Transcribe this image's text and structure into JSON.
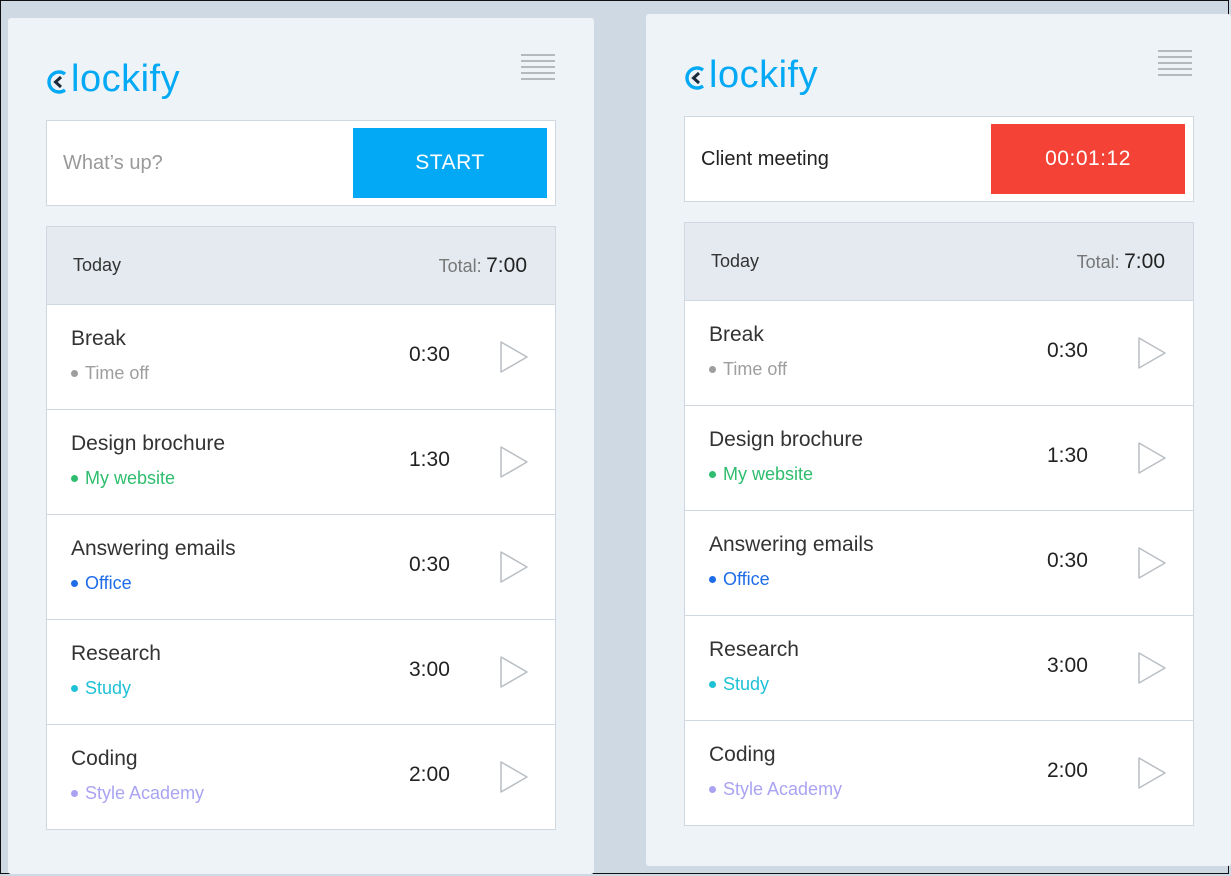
{
  "colors": {
    "brand": "#03a9f4",
    "start_button": "#03a9f4",
    "stop_button": "#f44336"
  },
  "panels": [
    {
      "logo": {
        "text": "lockify",
        "icon": "clockify-logo-icon"
      },
      "timer": {
        "description": "",
        "placeholder": "What’s up?",
        "button_label": "START",
        "running": false
      },
      "list": {
        "day_label": "Today",
        "total_label": "Total:",
        "total_value": "7:00",
        "entries": [
          {
            "description": "Break",
            "project": "Time off",
            "project_color": "#9e9e9e",
            "duration": "0:30"
          },
          {
            "description": "Design brochure",
            "project": "My website",
            "project_color": "#2ebd6e",
            "duration": "1:30"
          },
          {
            "description": "Answering emails",
            "project": "Office",
            "project_color": "#1e6ce8",
            "duration": "0:30"
          },
          {
            "description": "Research",
            "project": "Study",
            "project_color": "#1fc1d6",
            "duration": "3:00"
          },
          {
            "description": "Coding",
            "project": "Style Academy",
            "project_color": "#a9a3f2",
            "duration": "2:00"
          }
        ]
      }
    },
    {
      "logo": {
        "text": "lockify",
        "icon": "clockify-logo-icon"
      },
      "timer": {
        "description": "Client meeting",
        "placeholder": "",
        "button_label": "00:01:12",
        "running": true
      },
      "list": {
        "day_label": "Today",
        "total_label": "Total:",
        "total_value": "7:00",
        "entries": [
          {
            "description": "Break",
            "project": "Time off",
            "project_color": "#9e9e9e",
            "duration": "0:30"
          },
          {
            "description": "Design brochure",
            "project": "My website",
            "project_color": "#2ebd6e",
            "duration": "1:30"
          },
          {
            "description": "Answering emails",
            "project": "Office",
            "project_color": "#1e6ce8",
            "duration": "0:30"
          },
          {
            "description": "Research",
            "project": "Study",
            "project_color": "#1fc1d6",
            "duration": "3:00"
          },
          {
            "description": "Coding",
            "project": "Style Academy",
            "project_color": "#a9a3f2",
            "duration": "2:00"
          }
        ]
      }
    }
  ]
}
